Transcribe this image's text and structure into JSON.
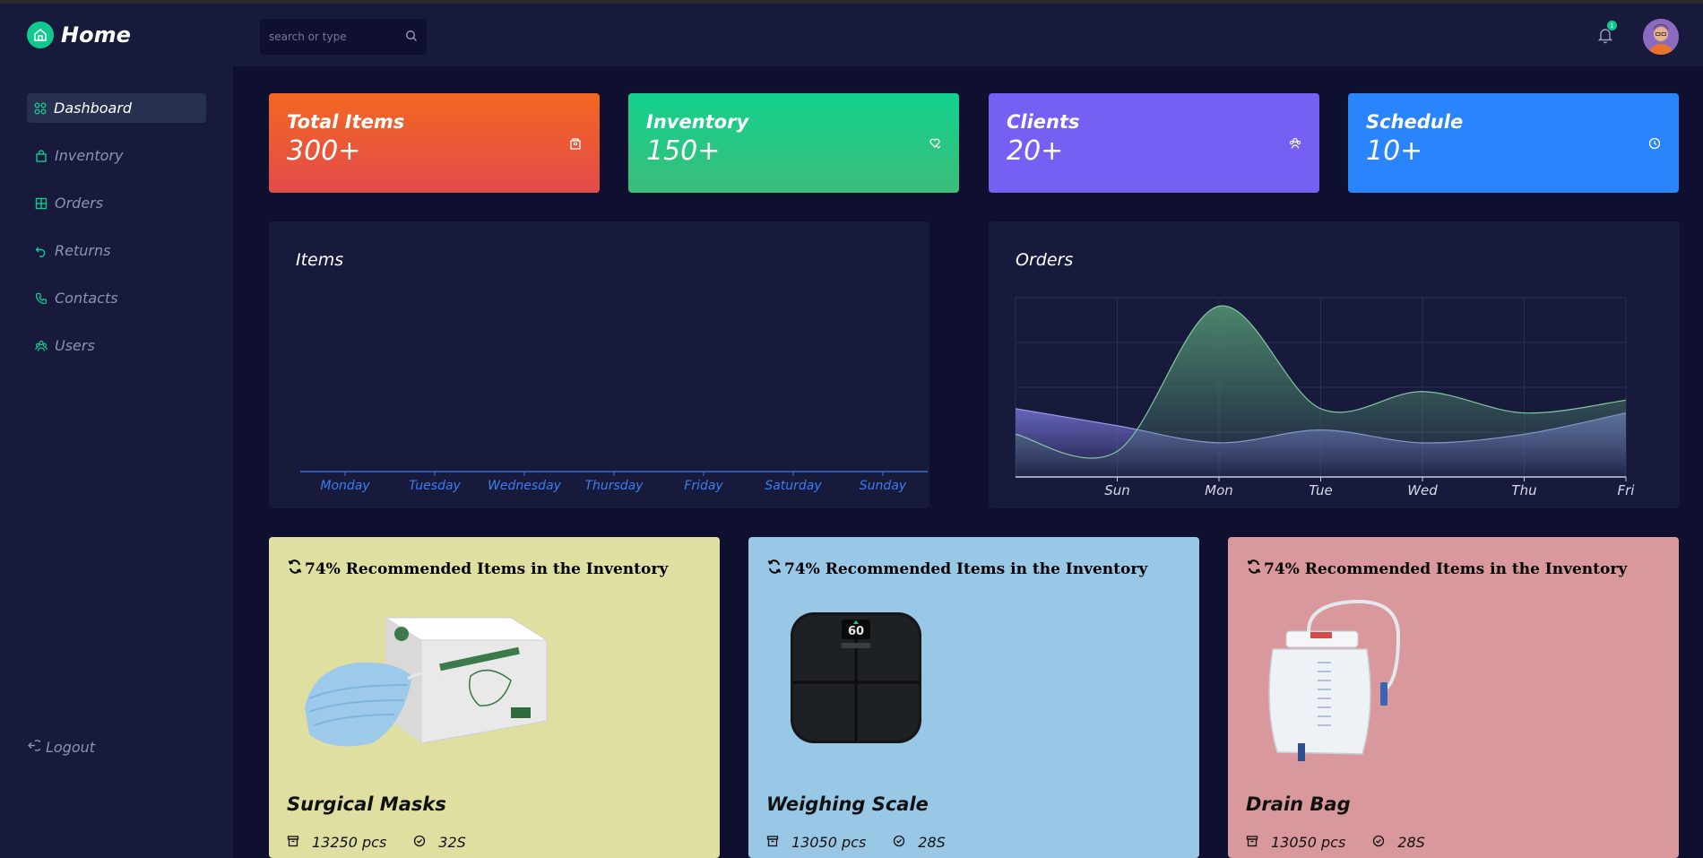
{
  "app": {
    "title": "Home"
  },
  "sidebar": {
    "items": [
      {
        "label": "Dashboard",
        "icon": "grid-icon",
        "active": true
      },
      {
        "label": "Inventory",
        "icon": "bag-icon",
        "active": false
      },
      {
        "label": "Orders",
        "icon": "table-icon",
        "active": false
      },
      {
        "label": "Returns",
        "icon": "undo-icon",
        "active": false
      },
      {
        "label": "Contacts",
        "icon": "phone-icon",
        "active": false
      },
      {
        "label": "Users",
        "icon": "users-icon",
        "active": false
      }
    ],
    "logout_label": "Logout"
  },
  "header": {
    "search_placeholder": "search or type",
    "notification_count": "1"
  },
  "stats": [
    {
      "title": "Total Items",
      "value": "300+",
      "icon": "archive-icon"
    },
    {
      "title": "Inventory",
      "value": "150+",
      "icon": "heart-hand-icon"
    },
    {
      "title": "Clients",
      "value": "20+",
      "icon": "users-icon"
    },
    {
      "title": "Schedule",
      "value": "10+",
      "icon": "clock-icon"
    }
  ],
  "panels": {
    "items_title": "Items",
    "orders_title": "Orders"
  },
  "chart_data": [
    {
      "type": "bar",
      "title": "Items",
      "categories": [
        "Monday",
        "Tuesday",
        "Wednesday",
        "Thursday",
        "Friday",
        "Saturday",
        "Sunday"
      ],
      "values": [
        0,
        0,
        0,
        0,
        0,
        0,
        0
      ],
      "grid": false
    },
    {
      "type": "area",
      "title": "Orders",
      "x": [
        "",
        "Sun",
        "Mon",
        "Tue",
        "Wed",
        "Thu",
        "Fri"
      ],
      "series": [
        {
          "color": "#4f8a6e",
          "values": [
            5,
            3,
            20,
            8,
            10,
            7.5,
            9
          ]
        },
        {
          "color": "#6b68c4",
          "values": [
            8,
            6,
            4,
            5.5,
            4,
            5,
            7.5
          ]
        }
      ],
      "ylim": [
        0,
        21
      ],
      "grid": true
    }
  ],
  "products": [
    {
      "heading": "74% Recommended Items in the Inventory",
      "name": "Surgical Masks",
      "stock": "13250 pcs",
      "code": "32S",
      "bg": "#e0dfa2"
    },
    {
      "heading": "74% Recommended Items in the Inventory",
      "name": "Weighing Scale",
      "stock": "13050 pcs",
      "code": "28S",
      "bg": "#98c8e5"
    },
    {
      "heading": "74% Recommended Items in the Inventory",
      "name": "Drain Bag",
      "stock": "13050 pcs",
      "code": "28S",
      "bg": "#d9989c"
    }
  ],
  "colors": {
    "accent": "#10c98f",
    "sidebar": "#181a3b",
    "background": "#0f1030"
  },
  "scale": {
    "display": "60"
  }
}
